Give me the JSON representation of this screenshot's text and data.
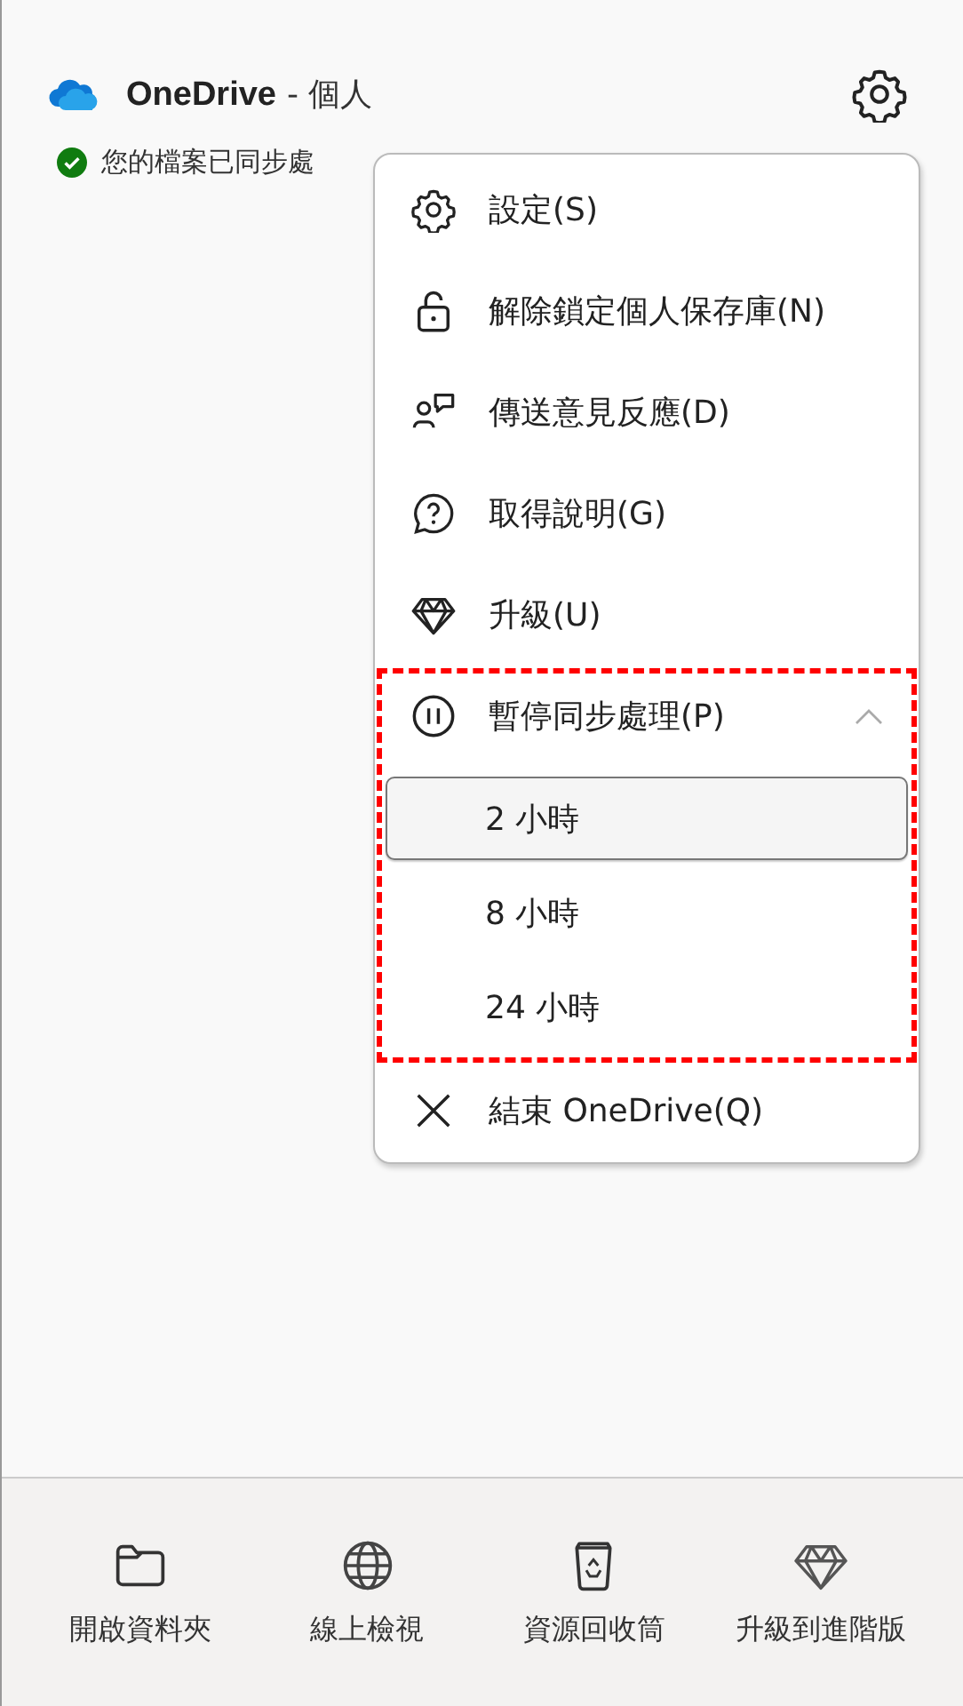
{
  "header": {
    "app_name": "OneDrive",
    "account": "- 個人",
    "status": "您的檔案已同步處"
  },
  "menu": {
    "items": [
      {
        "kind": "item",
        "label": "設定(S)"
      },
      {
        "kind": "item",
        "label": "解除鎖定個人保存庫(N)"
      },
      {
        "kind": "item",
        "label": "傳送意見反應(D)"
      },
      {
        "kind": "item",
        "label": "取得說明(G)"
      },
      {
        "kind": "item",
        "label": "升級(U)"
      },
      {
        "kind": "submenu",
        "label": "暫停同步處理(P)",
        "expanded": true,
        "highlighted": true,
        "options": [
          {
            "label": "2 小時",
            "selected": true
          },
          {
            "label": "8 小時",
            "selected": false
          },
          {
            "label": "24 小時",
            "selected": false
          }
        ]
      },
      {
        "kind": "item",
        "label": "結束 OneDrive(Q)"
      }
    ]
  },
  "footer": [
    {
      "label": "開啟資料夾"
    },
    {
      "label": "線上檢視"
    },
    {
      "label": "資源回收筒"
    },
    {
      "label": "升級到進階版"
    }
  ]
}
